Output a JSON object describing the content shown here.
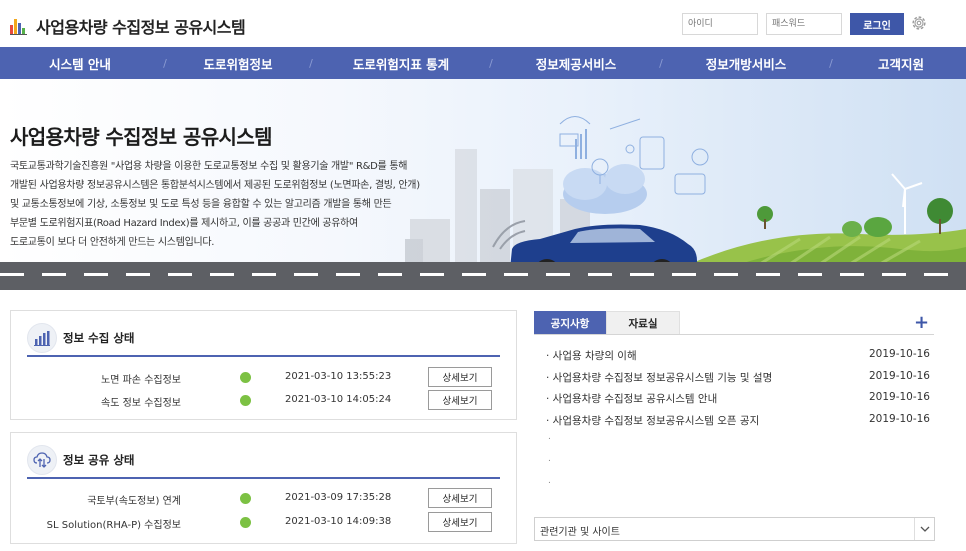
{
  "header": {
    "title": "사업용차량 수집정보 공유시스템",
    "id_placeholder": "아이디",
    "pw_placeholder": "패스워드",
    "login_label": "로그인",
    "accent": "#3e57a8"
  },
  "nav": {
    "items": [
      {
        "label": "시스템 안내"
      },
      {
        "label": "도로위험정보"
      },
      {
        "label": "도로위험지표 통계"
      },
      {
        "label": "정보제공서비스"
      },
      {
        "label": "정보개방서비스"
      },
      {
        "label": "고객지원"
      }
    ],
    "separator": "/",
    "color": "#4d63b1"
  },
  "hero": {
    "title": "사업용차량 수집정보 공유시스템",
    "desc": [
      "국토교통과학기술진흥원 \"사업용 차량을 이용한 도로교통정보 수집 및 활용기술 개발\" R&D를 통해",
      "개발된 사업용차량 정보공유시스템은 통합분석시스템에서 제공된 도로위험정보 (노면파손, 결빙, 안개)",
      "및 교통소통정보에 기상, 소통정보 및 도로 특성 등을 융합할 수 있는 알고리즘 개발을 통해 만든",
      "부문별  도로위험지표(Road Hazard Index)를 제시하고, 이를 공공과 민간에 공유하여",
      "도로교통이 보다 더 안전하게 만드는 시스템입니다."
    ]
  },
  "collection": {
    "title": "정보 수집 상태",
    "rows": [
      {
        "name": "노면 파손 수집정보",
        "time": "2021-03-10 13:55:23",
        "button": "상세보기",
        "status": "#7cc143"
      },
      {
        "name": "속도 정보 수집정보",
        "time": "2021-03-10 14:05:24",
        "button": "상세보기",
        "status": "#7cc143"
      }
    ]
  },
  "sharing": {
    "title": "정보 공유 상태",
    "rows": [
      {
        "name": "국토부(속도정보) 연계",
        "time": "2021-03-09 17:35:28",
        "button": "상세보기",
        "status": "#7cc143"
      },
      {
        "name": "SL Solution(RHA-P) 수집정보",
        "time": "2021-03-10 14:09:38",
        "button": "상세보기",
        "status": "#7cc143"
      }
    ]
  },
  "board": {
    "tabs": [
      {
        "label": "공지사항"
      },
      {
        "label": "자료실"
      }
    ],
    "more": "+",
    "notices": [
      {
        "title": "· 사업용 차량의 이해",
        "date": "2019-10-16"
      },
      {
        "title": "· 사업용차량 수집정보 정보공유시스템 기능 및 설명",
        "date": "2019-10-16"
      },
      {
        "title": "· 사업용차량 수집정보 공유시스템 안내",
        "date": "2019-10-16"
      },
      {
        "title": "· 사업용차량 수집정보 정보공유시스템 오픈 공지",
        "date": "2019-10-16"
      }
    ],
    "empty_bullets": [
      ".",
      ".",
      "."
    ]
  },
  "related": {
    "label": "관련기관 및 사이트",
    "icon": "chevron-down-icon"
  }
}
